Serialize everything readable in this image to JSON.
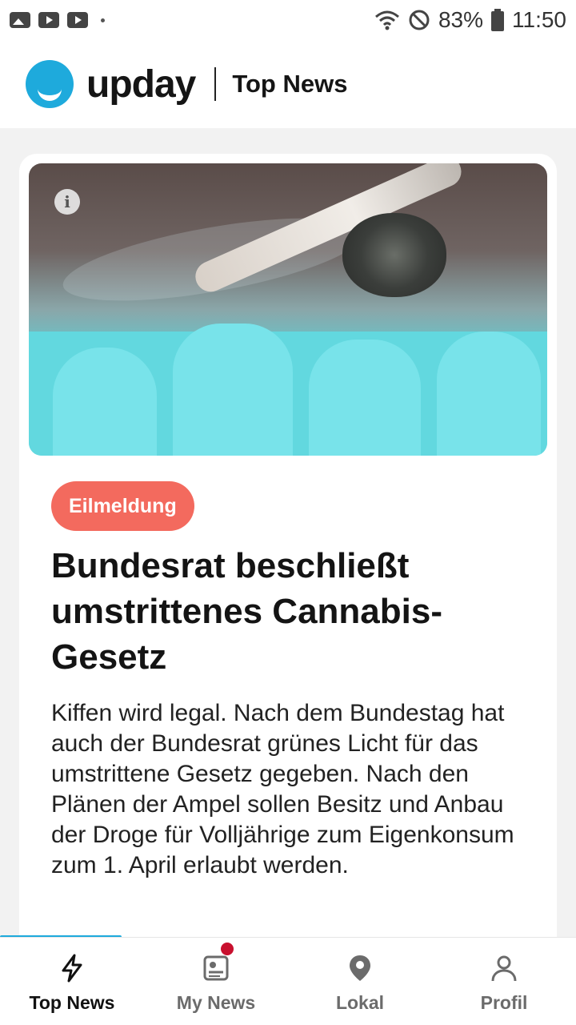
{
  "status_bar": {
    "battery": "83%",
    "time": "11:50",
    "icons": [
      "gallery-icon",
      "youtube-icon",
      "youtube-icon",
      "wifi-icon",
      "do-not-disturb-icon",
      "battery-icon"
    ]
  },
  "header": {
    "logo_text": "upday",
    "section": "Top News"
  },
  "article": {
    "badge": "Eilmeldung",
    "headline": "Bundesrat beschließt umstrittenes Cannabis-Gesetz",
    "summary": "Kiffen wird legal. Nach dem Bundestag hat auch der Bundesrat grünes Licht für das umstrittene Gesetz gegeben. Nach den Plänen der Ampel sollen Besitz und Anbau der Droge für Volljährige zum Eigenkonsum zum 1. April erlaubt werden.",
    "info_icon": "i"
  },
  "nav": {
    "items": [
      {
        "label": "Top News",
        "icon": "lightning-icon",
        "active": true
      },
      {
        "label": "My News",
        "icon": "news-icon",
        "active": false,
        "notification": true
      },
      {
        "label": "Lokal",
        "icon": "location-pin-icon",
        "active": false
      },
      {
        "label": "Profil",
        "icon": "person-icon",
        "active": false
      }
    ]
  },
  "colors": {
    "brand": "#1eaadc",
    "badge": "#f36a5e",
    "notification": "#c8102e"
  }
}
